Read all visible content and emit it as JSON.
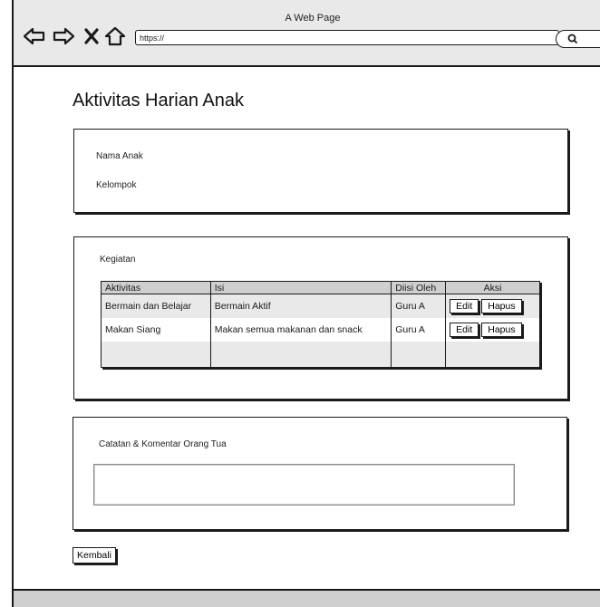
{
  "window": {
    "title": "A Web Page",
    "url": "https://"
  },
  "page": {
    "title": "Aktivitas Harian Anak"
  },
  "child_info": {
    "name_label": "Nama Anak",
    "group_label": "Kelompok"
  },
  "activities": {
    "section_label": "Kegiatan",
    "columns": [
      "Aktivitas",
      "Isi",
      "Diisi Oleh",
      "Aksi"
    ],
    "rows": [
      {
        "aktivitas": "Bermain dan Belajar",
        "isi": "Bermain Aktif",
        "diisi_oleh": "Guru A",
        "edit_label": "Edit",
        "delete_label": "Hapus"
      },
      {
        "aktivitas": "Makan Siang",
        "isi": "Makan semua makanan dan snack",
        "diisi_oleh": "Guru A",
        "edit_label": "Edit",
        "delete_label": "Hapus"
      }
    ]
  },
  "comments": {
    "label": "Catatan & Komentar Orang Tua",
    "value": ""
  },
  "footer": {
    "back_label": "Kembali"
  }
}
